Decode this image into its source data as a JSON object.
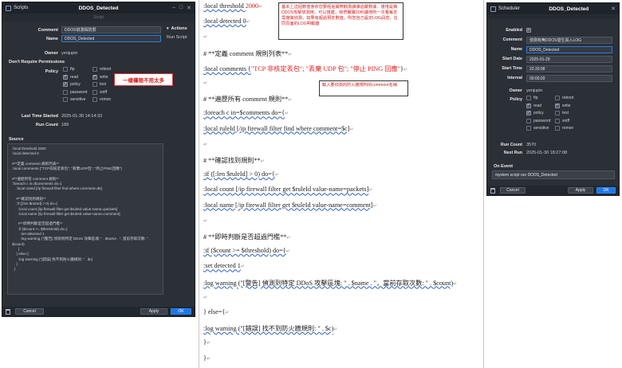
{
  "scripts": {
    "window_title": "Scripts",
    "center_title": "DDOS_Detected",
    "tab": "Script",
    "comment_label": "Comment",
    "comment_value": "DDOS偵測與防禦",
    "name_label": "Name",
    "name_value": "DDOS_Detected",
    "owner_label": "Owner",
    "owner_value": "yenjupin",
    "dont_require_label": "Don't Require Permissions",
    "policy_label": "Policy",
    "policies": [
      {
        "label": "ftp",
        "checked": false
      },
      {
        "label": "reboot",
        "checked": false
      },
      {
        "label": "read",
        "checked": true
      },
      {
        "label": "write",
        "checked": true
      },
      {
        "label": "policy",
        "checked": true
      },
      {
        "label": "test",
        "checked": false
      },
      {
        "label": "password",
        "checked": false
      },
      {
        "label": "sniff",
        "checked": false
      },
      {
        "label": "sensitive",
        "checked": false
      },
      {
        "label": "romon",
        "checked": false
      }
    ],
    "last_started_label": "Last Time Started",
    "last_started_value": "2025-01-30 14:14:33",
    "run_count_label": "Run Count",
    "run_count_value": "189",
    "source_label": "Source",
    "source_text": " :local threshold 2000\n :local detected 0\n\n #**定義 comment 規則列表**\n :local comments {\"TCP非核定丟包\"; \"丟棄UDP包\"; \"停止PING回應\"}\n\n #**遍歷所有 comment 規則**\n :foreach c in=$comments do={\n     :local ruleId [/ip firewall filter find where comment=$c]\n\n     #**確認找到規則**\n     :if ([:len $ruleId] > 0) do={\n       :local count [/ip firewall filter get $ruleId value-name=packets]\n       :local name [/ip firewall filter get $ruleId value-name=comment]\n\n       #**即時判斷是否超過門檻**\n       :if ($count >= $threshold) do={\n         :set detected 1\n         :log warning (\"[警告] 偵測到特定 DDoS 攻擊區塊: \" . $name . \", 當前存取次數: \" .\n $count)\n       }\n     } else={\n       :log warning (\"[錯誤] 找不到防火牆規則: \" . $c)\n     }\n   }",
    "actions_label": "Actions",
    "run_script": "Run Script",
    "cancel": "Cancel",
    "apply": "Apply",
    "ok": "OK"
  },
  "annotation_left": "一樣權限不用太多",
  "doc": {
    "lines": [
      {
        "pre": ":local threshold ",
        "hl": "2000",
        "post": ""
      },
      {
        "pre": ":local detected 0",
        "hl": "",
        "post": ""
      },
      {
        "pre": "",
        "hl": "",
        "post": ""
      },
      {
        "pre": "# **定義  comment  規則列表**",
        "hl": "",
        "post": ""
      },
      {
        "pre": ":local comments {",
        "hl": "\"TCP 非核定丟包\"; \"丟棄 UDP 包\"; \"停止 PING 回應\"",
        "post": "}"
      },
      {
        "pre": "",
        "hl": "",
        "post": ""
      },
      {
        "pre": "# **遍歷所有  comment  規則**",
        "hl": "",
        "post": ""
      },
      {
        "pre": ":foreach c in=$comments do={",
        "hl": "",
        "post": ""
      },
      {
        "pre": ":local ruleId [/ip firewall filter find where comment=$c]",
        "hl": "",
        "post": ""
      },
      {
        "pre": "",
        "hl": "",
        "post": ""
      },
      {
        "pre": "# **確認找到規則**",
        "hl": "",
        "post": ""
      },
      {
        "pre": ":if ([:len $ruleId] > 0) do={",
        "hl": "",
        "post": ""
      },
      {
        "pre": ":local count [/ip firewall filter get $ruleId value-name=packets]",
        "hl": "",
        "post": ""
      },
      {
        "pre": ":local name [/ip firewall filter get $ruleId value-name=comment]",
        "hl": "",
        "post": ""
      },
      {
        "pre": "",
        "hl": "",
        "post": ""
      },
      {
        "pre": "# **即時判斷是否超過門檻**",
        "hl": "",
        "post": ""
      },
      {
        "pre": ":if ($count >= $threshold) do={",
        "hl": "",
        "post": ""
      },
      {
        "pre": ":set detected 1",
        "hl": "",
        "post": ""
      },
      {
        "pre": ":log warning (\"[警告]  偵測到特定  DDoS  攻擊區塊: \" . $name . \"，當前存取次數: \" . $count)",
        "hl": "",
        "post": ""
      },
      {
        "pre": "",
        "hl": "",
        "post": ""
      },
      {
        "pre": "} else={",
        "hl": "",
        "post": ""
      },
      {
        "pre": ":log warning (\"[錯誤]  找不到防火牆規則: \" . $c)",
        "hl": "",
        "post": ""
      },
      {
        "pre": "}",
        "hl": "",
        "post": ""
      },
      {
        "pre": "}",
        "hl": "",
        "post": ""
      }
    ],
    "paragraph_mark": "↵",
    "note1": "基本上這個數值會依您要經過實際觀測誰誰過嚴數據，僅僅是做DDOS攻擊偵測用，可以搭建，我們爾爾20秒讀地則一次看每定需複做偵測，如果有超過預定數值，則您自己設定LOG訊息，在同頁面的LOG明報器",
    "note2": "輸入要偵測的防火牆規則的comment名稱"
  },
  "scheduler": {
    "window_title": "Scheduler",
    "center_title": "DDOS_Detected",
    "enabled_label": "Enabled",
    "comment_label": "Comment",
    "comment_value": "偵測有無DDOS發生與入LOG",
    "name_label": "Name",
    "name_value": "DDOS_Detected",
    "start_date_label": "Start Date",
    "start_date_value": "2025-01-29",
    "start_time_label": "Start Time",
    "start_time_value": "22:33:08",
    "interval_label": "Interval",
    "interval_value": "00:00:20",
    "owner_label": "Owner",
    "owner_value": "yenjupin",
    "policy_label": "Policy",
    "policies": [
      {
        "label": "ftp",
        "checked": false
      },
      {
        "label": "reboot",
        "checked": false
      },
      {
        "label": "read",
        "checked": true
      },
      {
        "label": "write",
        "checked": true
      },
      {
        "label": "policy",
        "checked": true
      },
      {
        "label": "test",
        "checked": false
      },
      {
        "label": "password",
        "checked": false
      },
      {
        "label": "sniff",
        "checked": false
      },
      {
        "label": "sensitive",
        "checked": false
      },
      {
        "label": "romon",
        "checked": false
      }
    ],
    "run_count_label": "Run Count",
    "run_count_value": "3570",
    "next_run_label": "Next Run",
    "next_run_value": "2025-01-30 18:27:08",
    "on_event_label": "On Event",
    "on_event_value": "/system script run DDOS_Detected",
    "cancel": "Cancel",
    "apply": "Apply",
    "ok": "OK"
  },
  "colors": {
    "window_bg": "#2b2f36",
    "accent": "#1e78e6",
    "annotation": "#e02020"
  }
}
